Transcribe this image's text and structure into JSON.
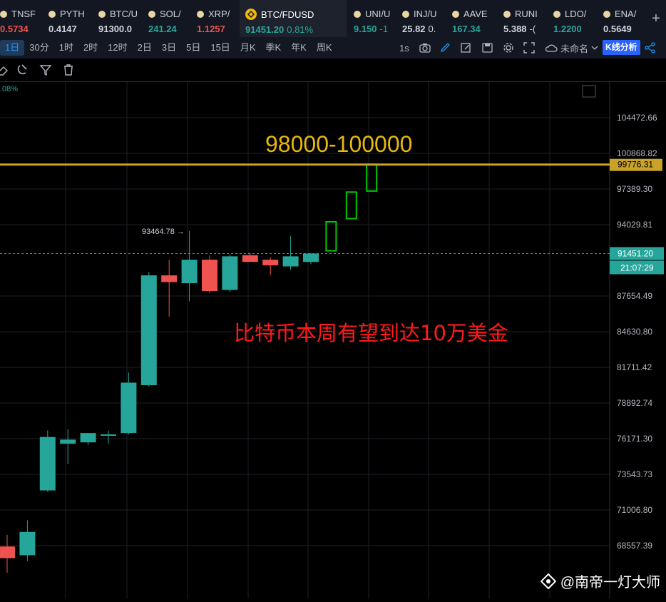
{
  "tickers": [
    {
      "symbol": "TNSF",
      "price": "0.5734",
      "dir": "dn"
    },
    {
      "symbol": "PYTH",
      "price": "0.4147",
      "dir": "neu"
    },
    {
      "symbol": "BTC/U",
      "price": "91300.0",
      "dir": "neu"
    },
    {
      "symbol": "SOL/",
      "price": "241.24",
      "dir": "up"
    },
    {
      "symbol": "XRP/",
      "price": "1.1257",
      "dir": "dn"
    },
    {
      "symbol": "BTC/FDUSD",
      "price": "91451.20",
      "change": "0.81%",
      "dir": "up",
      "active": true
    },
    {
      "symbol": "UNI/U",
      "price": "9.150",
      "change": "-1",
      "dir": "up"
    },
    {
      "symbol": "INJ/U",
      "price": "25.82",
      "change": "0.",
      "dir": "neu"
    },
    {
      "symbol": "AAVE",
      "price": "167.34",
      "dir": "up"
    },
    {
      "symbol": "RUNI",
      "price": "5.388",
      "change": "-(",
      "dir": "neu"
    },
    {
      "symbol": "LDO/",
      "price": "1.2200",
      "dir": "up"
    },
    {
      "symbol": "ENA/",
      "price": "0.5649",
      "dir": "neu"
    }
  ],
  "timeframes": [
    "1日",
    "30分",
    "1时",
    "2时",
    "12时",
    "2日",
    "3日",
    "5日",
    "15日",
    "月K",
    "季K",
    "年K",
    "周K"
  ],
  "selected_timeframe": "1日",
  "toolbar": {
    "interval": "1s",
    "layout_name": "未命名",
    "kline_analysis": "K线分析"
  },
  "chart": {
    "pct_label": ".08%",
    "annotation_target": "98000-100000",
    "annotation_cn": "比特币本周有望到达10万美金",
    "high_marker": "93464.78 →",
    "target_line_price": "99776.31",
    "current_price": "91451.20",
    "countdown": "21:07:29",
    "colors": {
      "up": "#26a69a",
      "down": "#ef5350",
      "target_line": "#c9a227",
      "projection": "#00c800",
      "annotation_red": "#ff1a1a",
      "annotation_gold": "#e8b90c"
    }
  },
  "chart_data": {
    "type": "candlestick",
    "y_axis_ticks": [
      "104472.66",
      "100868.82",
      "97389.30",
      "94029.81",
      "87654.49",
      "84630.80",
      "81711.42",
      "78892.74",
      "76171.30",
      "73543.73",
      "71006.80",
      "68557.39"
    ],
    "candles": [
      {
        "o": 68500,
        "h": 69300,
        "l": 66700,
        "c": 67700
      },
      {
        "o": 67900,
        "h": 70300,
        "l": 67500,
        "c": 69500
      },
      {
        "o": 72400,
        "h": 76800,
        "l": 72300,
        "c": 76300
      },
      {
        "o": 75800,
        "h": 76900,
        "l": 74300,
        "c": 76100
      },
      {
        "o": 75900,
        "h": 76400,
        "l": 75700,
        "c": 76600
      },
      {
        "o": 76400,
        "h": 76800,
        "l": 75800,
        "c": 76500
      },
      {
        "o": 76600,
        "h": 81300,
        "l": 76500,
        "c": 80500
      },
      {
        "o": 80300,
        "h": 89800,
        "l": 80200,
        "c": 89500
      },
      {
        "o": 89500,
        "h": 90900,
        "l": 85900,
        "c": 88900
      },
      {
        "o": 88800,
        "h": 93464.78,
        "l": 87200,
        "c": 90900
      },
      {
        "o": 90900,
        "h": 91300,
        "l": 87900,
        "c": 88100
      },
      {
        "o": 88200,
        "h": 91400,
        "l": 88000,
        "c": 91200
      },
      {
        "o": 91300,
        "h": 91500,
        "l": 90700,
        "c": 90700
      },
      {
        "o": 90900,
        "h": 91100,
        "l": 89500,
        "c": 90400
      },
      {
        "o": 90300,
        "h": 93000,
        "l": 90000,
        "c": 91200
      },
      {
        "o": 90700,
        "h": 91500,
        "l": 90500,
        "c": 91451.2
      }
    ],
    "projection": [
      {
        "o": 91700,
        "c": 94300
      },
      {
        "o": 94600,
        "c": 97100
      },
      {
        "o": 97200,
        "c": 99800
      }
    ]
  }
}
